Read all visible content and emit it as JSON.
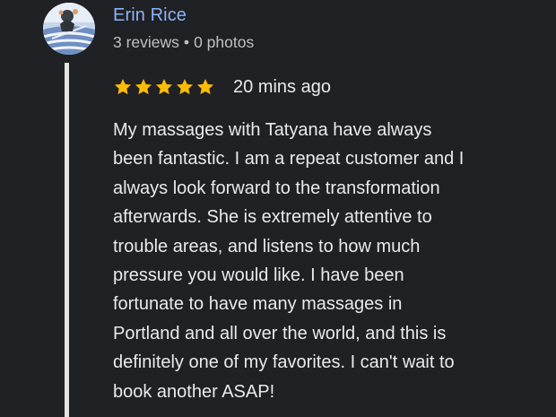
{
  "review": {
    "author_name": "Erin Rice",
    "stats": {
      "reviews": "3 reviews",
      "separator": "•",
      "photos": "0 photos"
    },
    "rating": 5,
    "max_rating": 5,
    "time": "20 mins ago",
    "star_color": "#fbbc04",
    "text_lines": [
      "My massages with Tatyana have always",
      "been fantastic. I am a repeat customer and I",
      "always look forward to the transformation",
      "afterwards. She is extremely attentive to",
      "trouble areas, and listens to how much",
      "pressure you would like. I have been",
      "fortunate to have many massages in",
      "Portland and all over the world, and this is",
      "definitely one of my favorites. I can't wait to",
      "book another ASAP!"
    ]
  },
  "icons": {
    "avatar": "avatar-image",
    "star": "star-icon"
  },
  "colors": {
    "background": "#202124",
    "author_link": "#8ab4f8",
    "secondary_text": "#bdc1c6",
    "primary_text": "#e8eaed",
    "thread_line": "#e3e3e3"
  }
}
